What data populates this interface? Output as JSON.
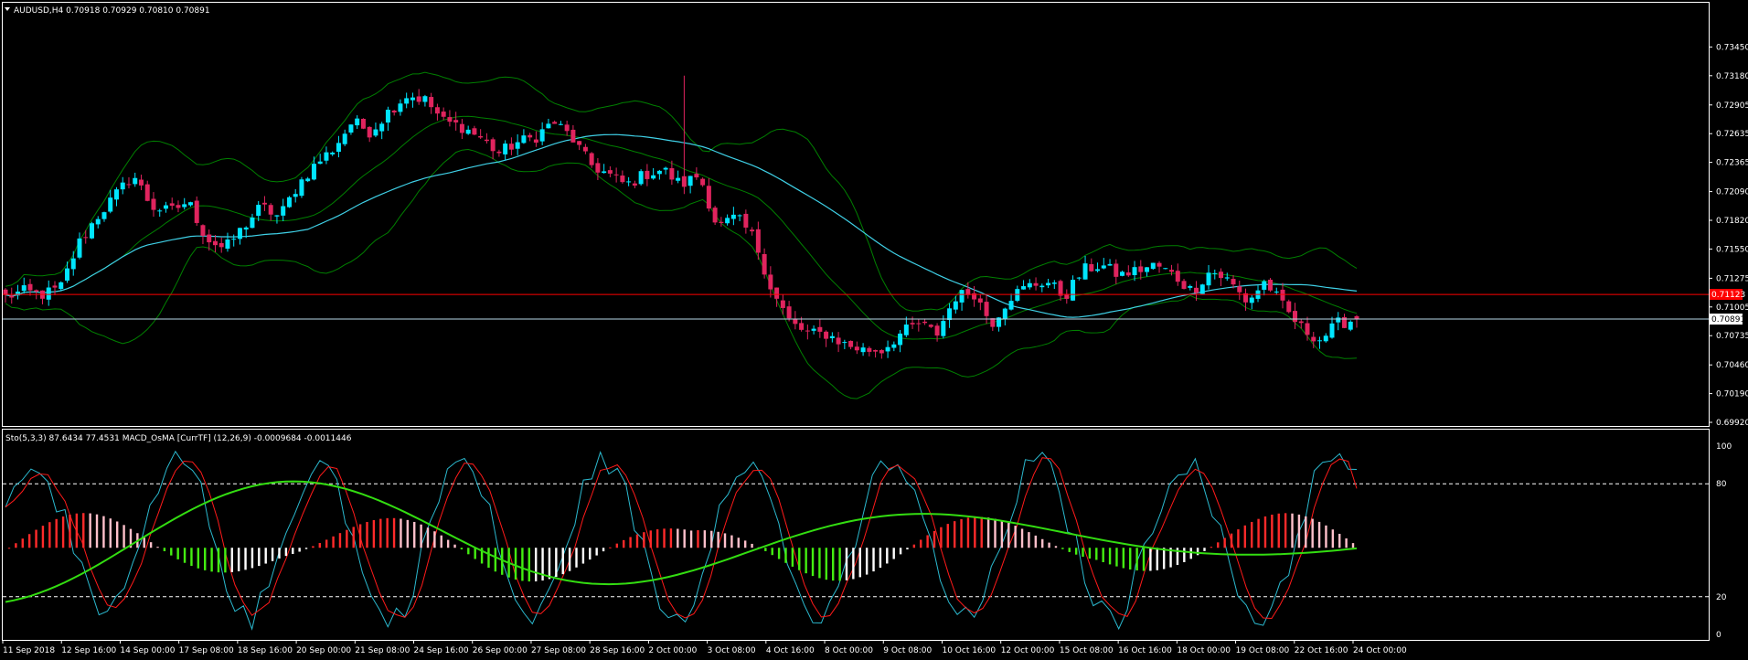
{
  "header": {
    "symbol_line": "AUDUSD,H4  0.70918 0.70929 0.70810 0.70891",
    "indicator_line": "Sto(5,3,3) 87.6434 77.4531  MACD_OsMA [CurrTF] (12,26,9) -0.0009684 -0.0011446"
  },
  "colors": {
    "background": "#000000",
    "bull_candle": "#00e5ff",
    "bear_candle": "#e0245e",
    "band": "#008000",
    "ma": "#3fd0e6",
    "red_level": "#ff0000",
    "current_level": "#b8d8e8",
    "stoch_k": "#2bb9cf",
    "stoch_d": "#ff1a1a",
    "signal": "#33dd11",
    "hist_pos_strong": "#ff2a2a",
    "hist_pos_weak": "#ffc0cb",
    "hist_neg_strong": "#44ee11",
    "hist_neg_weak": "#ffffff"
  },
  "chart_data": [
    {
      "type": "candlestick",
      "symbol": "AUDUSD",
      "timeframe": "H4",
      "ohlc_current": {
        "open": 0.70918,
        "high": 0.70929,
        "low": 0.7081,
        "close": 0.70891
      },
      "y_ticks": [
        "0.73450",
        "0.73180",
        "0.72905",
        "0.72635",
        "0.72365",
        "0.72090",
        "0.71820",
        "0.71550",
        "0.71275",
        "0.71005",
        "0.70735",
        "0.70460",
        "0.70190",
        "0.69920"
      ],
      "ylim": [
        0.6992,
        0.7372
      ],
      "x_tick_labels": [
        "11 Sep 2018",
        "12 Sep 16:00",
        "14 Sep 00:00",
        "17 Sep 08:00",
        "18 Sep 16:00",
        "20 Sep 00:00",
        "21 Sep 08:00",
        "24 Sep 16:00",
        "26 Sep 00:00",
        "27 Sep 08:00",
        "28 Sep 16:00",
        "2 Oct 00:00",
        "3 Oct 08:00",
        "4 Oct 16:00",
        "8 Oct 00:00",
        "9 Oct 08:00",
        "10 Oct 16:00",
        "12 Oct 00:00",
        "15 Oct 08:00",
        "16 Oct 16:00",
        "18 Oct 00:00",
        "19 Oct 08:00",
        "22 Oct 16:00",
        "24 Oct 00:00"
      ],
      "close_path": [
        0.711,
        0.7115,
        0.7112,
        0.7118,
        0.716,
        0.7185,
        0.7205,
        0.7225,
        0.7195,
        0.719,
        0.72,
        0.7165,
        0.7155,
        0.7175,
        0.7195,
        0.7185,
        0.7215,
        0.7235,
        0.725,
        0.7275,
        0.7265,
        0.7285,
        0.73,
        0.7295,
        0.7275,
        0.727,
        0.726,
        0.7245,
        0.7255,
        0.726,
        0.7275,
        0.726,
        0.7235,
        0.7225,
        0.7215,
        0.7225,
        0.723,
        0.7215,
        0.7225,
        0.7175,
        0.7185,
        0.7165,
        0.7115,
        0.7085,
        0.7075,
        0.7075,
        0.7065,
        0.706,
        0.706,
        0.7075,
        0.7085,
        0.7075,
        0.711,
        0.7115,
        0.7085,
        0.711,
        0.712,
        0.7125,
        0.711,
        0.7135,
        0.714,
        0.713,
        0.7135,
        0.714,
        0.713,
        0.7115,
        0.7135,
        0.7125,
        0.7105,
        0.7125,
        0.71,
        0.708,
        0.707,
        0.7085,
        0.7089
      ],
      "price_markers": [
        {
          "value": "0.71123",
          "price": 0.71123
        },
        {
          "value": "0.70891",
          "price": 0.70891
        }
      ]
    },
    {
      "type": "oscillator",
      "name": "Sto(5,3,3) + MACD_OsMA",
      "k_value": 87.6434,
      "d_value": 77.4531,
      "osma_value": -0.0009684,
      "signal_value": -0.0011446,
      "y_ticks": [
        "100",
        "80",
        "20",
        "0"
      ],
      "levels": [
        80,
        20
      ],
      "ylim": [
        0,
        100
      ]
    }
  ]
}
